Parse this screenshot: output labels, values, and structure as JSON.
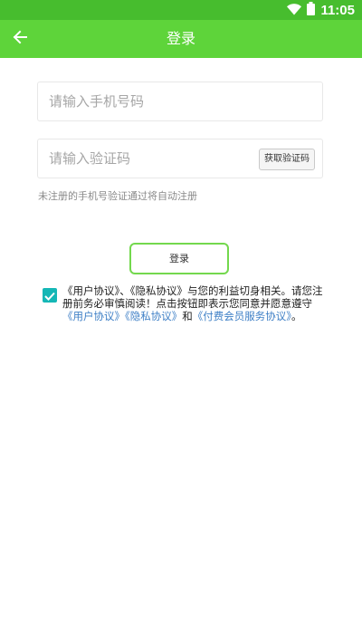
{
  "status_bar": {
    "time": "11:05",
    "wifi_icon": "wifi-icon",
    "battery_icon": "battery-icon"
  },
  "app_bar": {
    "title": "登录",
    "back_icon": "arrow-left-icon"
  },
  "form": {
    "phone_placeholder": "请输入手机号码",
    "phone_value": "",
    "code_placeholder": "请输入验证码",
    "code_value": "",
    "get_code_label": "获取验证码",
    "hint": "未注册的手机号验证通过将自动注册"
  },
  "login_button": "登录",
  "agreement": {
    "checked": true,
    "text_1": "《用户协议》、《隐私协议》与您的利益切身相关。请您注册前务必审慎阅读！点击按钮即表示您同意并愿意遵守",
    "link_user": "《用户协议》",
    "link_privacy": "《隐私协议》",
    "text_and": "和",
    "link_vip": "《付费会员服务协议》",
    "text_end": "。"
  },
  "colors": {
    "status_bar": "#47bd2e",
    "app_bar": "#5ed43a",
    "checkbox": "#15b7b6",
    "link": "#3e7fc6",
    "login_border": "#73d84d"
  }
}
